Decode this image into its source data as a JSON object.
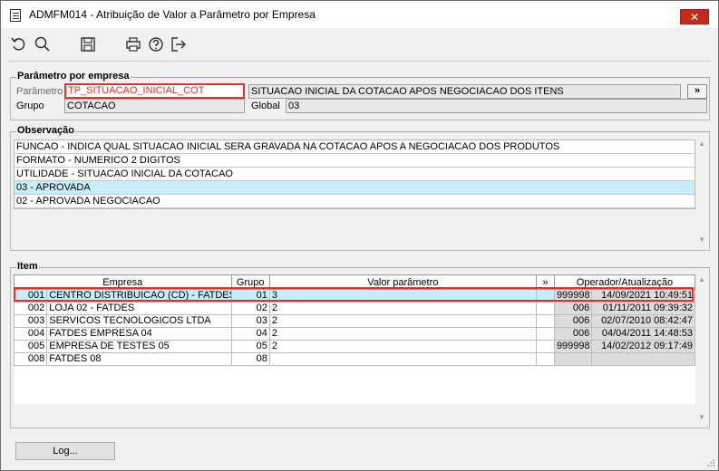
{
  "window": {
    "title": "ADMFM014 - Atribuição de Valor a Parâmetro por Empresa",
    "close_label": "✕"
  },
  "toolbar": {
    "icons": [
      "undo-icon",
      "search-icon",
      "save-icon",
      "print-icon",
      "help-icon",
      "exit-icon"
    ]
  },
  "parametro": {
    "section_title": "Parâmetro por empresa",
    "parametro_label": "Parâmetro",
    "parametro_value": "TP_SITUACAO_INICIAL_COT",
    "parametro_desc": "SITUACAO INICIAL DA COTACAO APOS NEGOCIACAO DOS ITENS",
    "more_button": "»",
    "grupo_label": "Grupo",
    "grupo_value": "COTACAO",
    "global_label": "Global",
    "global_value": "03"
  },
  "observacao": {
    "section_title": "Observação",
    "lines": [
      "FUNCAO - INDICA QUAL SITUACAO INICIAL SERA GRAVADA NA COTACAO APOS A NEGOCIACAO DOS PRODUTOS",
      "FORMATO - NUMERICO 2 DIGITOS",
      "UTILIDADE - SITUACAO INICIAL DA COTACAO",
      "03 - APROVADA",
      "02 - APROVADA NEGOCIACAO"
    ],
    "selected_index": 3
  },
  "item": {
    "section_title": "Item",
    "headers": {
      "empresa": "Empresa",
      "grupo": "Grupo",
      "valor": "Valor parâmetro",
      "more": "»",
      "operador": "Operador/Atualização"
    },
    "rows": [
      {
        "code": "001",
        "name": "CENTRO DISTRIBUICAO (CD) - FATDES",
        "grupo": "01",
        "valor": "3",
        "operador": "999998",
        "data": "14/09/2021 10:49:51"
      },
      {
        "code": "002",
        "name": "LOJA 02 - FATDES",
        "grupo": "02",
        "valor": "2",
        "operador": "006",
        "data": "01/11/2011 09:39:32"
      },
      {
        "code": "003",
        "name": "SERVICOS TECNOLOGICOS LTDA",
        "grupo": "03",
        "valor": "2",
        "operador": "006",
        "data": "02/07/2010 08:42:47"
      },
      {
        "code": "004",
        "name": "FATDES EMPRESA 04",
        "grupo": "04",
        "valor": "2",
        "operador": "006",
        "data": "04/04/2011 14:48:53"
      },
      {
        "code": "005",
        "name": "EMPRESA DE TESTES 05",
        "grupo": "05",
        "valor": "2",
        "operador": "999998",
        "data": "14/02/2012 09:17:49"
      },
      {
        "code": "008",
        "name": "FATDES 08",
        "grupo": "08",
        "valor": "",
        "operador": "",
        "data": ""
      }
    ],
    "selected_index": 0
  },
  "footer": {
    "log_button": "Log..."
  }
}
